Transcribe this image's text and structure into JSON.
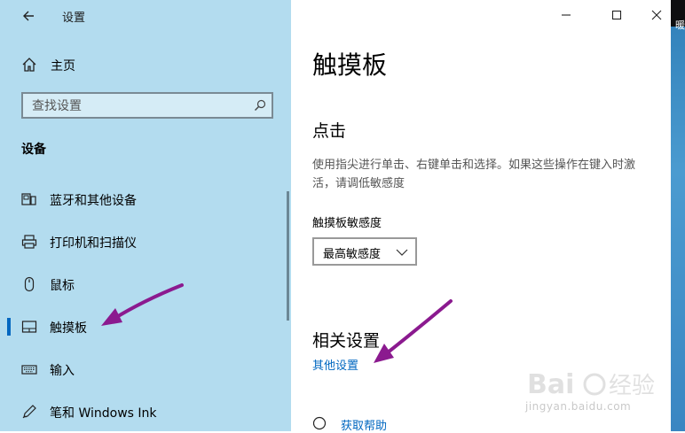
{
  "window": {
    "title": "设置"
  },
  "sidebar": {
    "home_label": "主页",
    "search_placeholder": "查找设置",
    "section_title": "设备",
    "items": [
      {
        "label": "蓝牙和其他设备",
        "icon": "bluetooth-devices-icon"
      },
      {
        "label": "打印机和扫描仪",
        "icon": "printer-icon"
      },
      {
        "label": "鼠标",
        "icon": "mouse-icon"
      },
      {
        "label": "触摸板",
        "icon": "touchpad-icon",
        "selected": true
      },
      {
        "label": "输入",
        "icon": "keyboard-icon"
      },
      {
        "label": "笔和 Windows Ink",
        "icon": "pen-icon"
      }
    ]
  },
  "main": {
    "page_title": "触摸板",
    "tap_section": {
      "title": "点击",
      "description": "使用指尖进行单击、右键单击和选择。如果这些操作在键入时激活，请调低敏感度",
      "sensitivity_label": "触摸板敏感度",
      "sensitivity_value": "最高敏感度"
    },
    "related": {
      "title": "相关设置",
      "other_settings_link": "其他设置"
    },
    "help_link": "获取帮助"
  },
  "watermark": {
    "text": "jingyan.baidu.com"
  },
  "edge_strip": {
    "glyph": "暖"
  },
  "colors": {
    "sidebar_bg": "#b3dcef",
    "accent": "#0067c0",
    "annotation_arrow": "#8b1a8f"
  }
}
